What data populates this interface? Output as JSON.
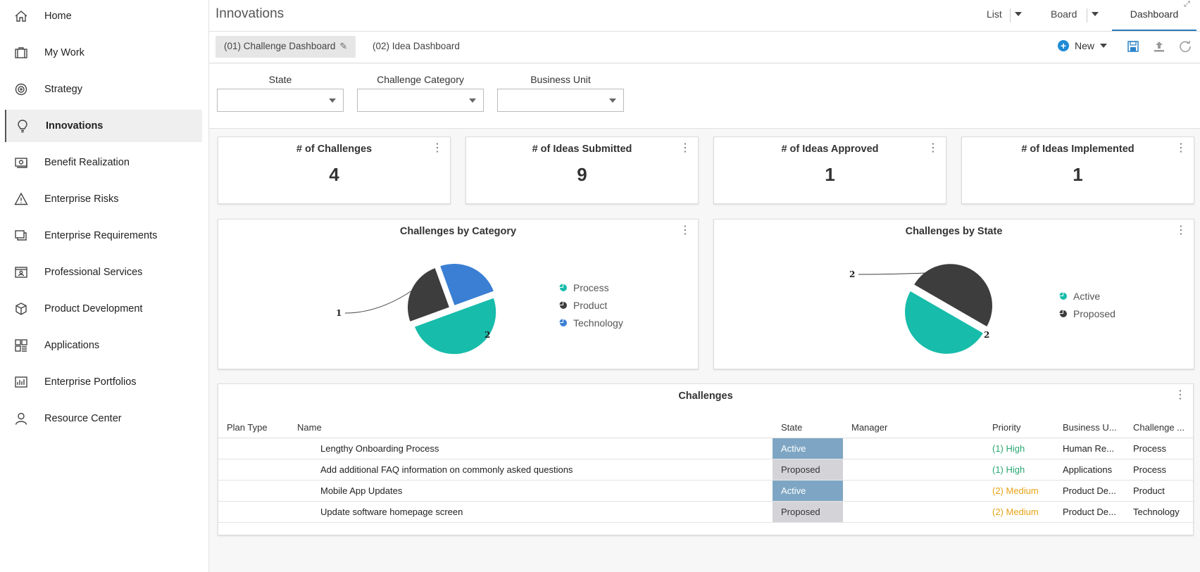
{
  "sidebar": {
    "items": [
      {
        "label": "Home",
        "icon": "home-icon"
      },
      {
        "label": "My Work",
        "icon": "briefcase-icon"
      },
      {
        "label": "Strategy",
        "icon": "target-icon"
      },
      {
        "label": "Innovations",
        "icon": "lightbulb-icon"
      },
      {
        "label": "Benefit Realization",
        "icon": "money-icon"
      },
      {
        "label": "Enterprise Risks",
        "icon": "warning-icon"
      },
      {
        "label": "Enterprise Requirements",
        "icon": "documents-icon"
      },
      {
        "label": "Professional Services",
        "icon": "id-card-icon"
      },
      {
        "label": "Product Development",
        "icon": "cube-icon"
      },
      {
        "label": "Applications",
        "icon": "grid-icon"
      },
      {
        "label": "Enterprise Portfolios",
        "icon": "bar-chart-icon"
      },
      {
        "label": "Resource Center",
        "icon": "person-icon"
      }
    ],
    "active_index": 3
  },
  "header": {
    "title": "Innovations",
    "views": {
      "list": "List",
      "board": "Board",
      "dashboard": "Dashboard"
    }
  },
  "tabs": {
    "challenge": "(01) Challenge Dashboard",
    "idea": "(02) Idea Dashboard"
  },
  "toolbar": {
    "new_label": "New"
  },
  "filters": {
    "state_label": "State",
    "category_label": "Challenge Category",
    "unit_label": "Business Unit"
  },
  "kpis": [
    {
      "title": "# of Challenges",
      "value": "4"
    },
    {
      "title": "# of Ideas Submitted",
      "value": "9"
    },
    {
      "title": "# of Ideas Approved",
      "value": "1"
    },
    {
      "title": "# of Ideas Implemented",
      "value": "1"
    }
  ],
  "chart_data": [
    {
      "type": "pie",
      "title": "Challenges by Category",
      "categories": [
        "Process",
        "Product",
        "Technology"
      ],
      "values": [
        2,
        1,
        1
      ],
      "colors": [
        "#17bcaa",
        "#3d3d3d",
        "#3a7fd4"
      ],
      "data_labels": [
        "2",
        "1"
      ],
      "legend": "right"
    },
    {
      "type": "pie",
      "title": "Challenges by State",
      "categories": [
        "Active",
        "Proposed"
      ],
      "values": [
        2,
        2
      ],
      "colors": [
        "#17bcaa",
        "#3d3d3d"
      ],
      "data_labels": [
        "2",
        "2"
      ],
      "legend": "right"
    }
  ],
  "challenges_table": {
    "title": "Challenges",
    "columns": [
      "Plan Type",
      "Name",
      "State",
      "Manager",
      "Priority",
      "Business U...",
      "Challenge ..."
    ],
    "rows": [
      {
        "plan_type": "",
        "name": "Lengthy Onboarding Process",
        "state": "Active",
        "manager": "",
        "priority": "(1) High",
        "business_unit": "Human Re...",
        "category": "Process"
      },
      {
        "plan_type": "",
        "name": "Add additional FAQ information on commonly asked questions",
        "state": "Proposed",
        "manager": "",
        "priority": "(1) High",
        "business_unit": "Applications",
        "category": "Process"
      },
      {
        "plan_type": "",
        "name": "Mobile App Updates",
        "state": "Active",
        "manager": "",
        "priority": "(2) Medium",
        "business_unit": "Product De...",
        "category": "Product"
      },
      {
        "plan_type": "",
        "name": "Update software homepage screen",
        "state": "Proposed",
        "manager": "",
        "priority": "(2) Medium",
        "business_unit": "Product De...",
        "category": "Technology"
      }
    ]
  }
}
